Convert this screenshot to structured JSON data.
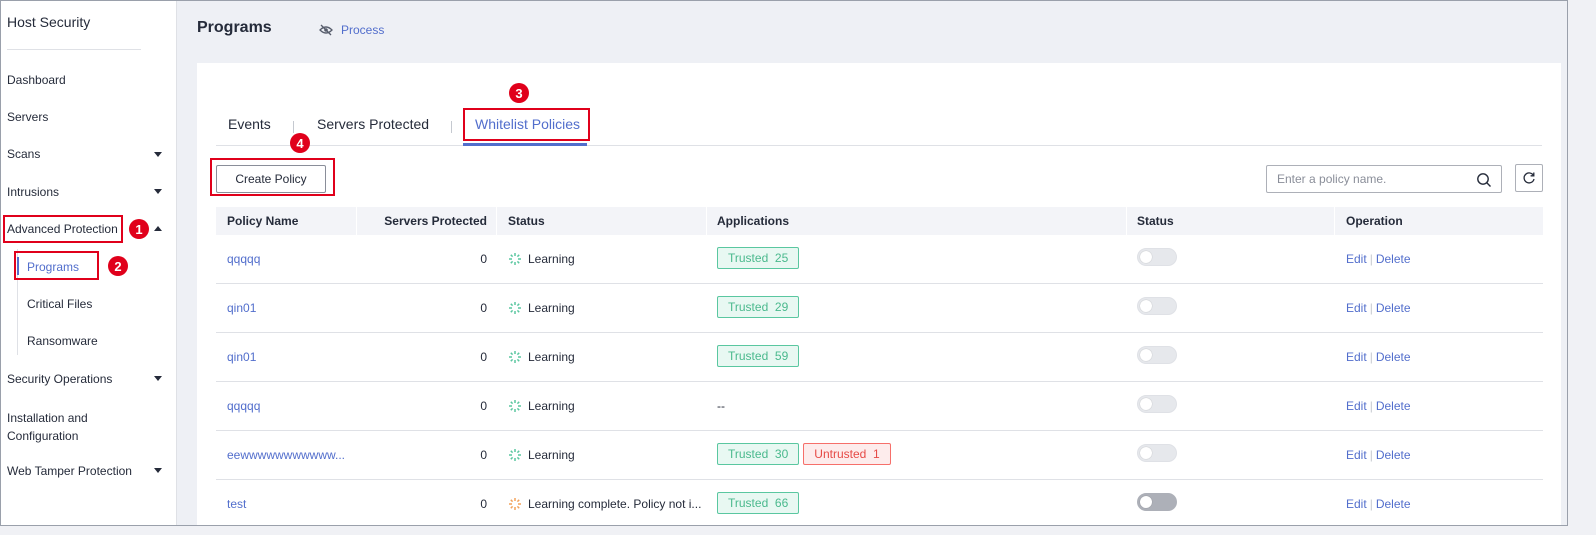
{
  "sidebar": {
    "title": "Host Security",
    "items": [
      {
        "label": "Dashboard"
      },
      {
        "label": "Servers"
      },
      {
        "label": "Scans"
      },
      {
        "label": "Intrusions"
      },
      {
        "label": "Advanced Protection"
      },
      {
        "label": "Security Operations"
      },
      {
        "label": "Installation and Configuration"
      },
      {
        "label": "Web Tamper Protection"
      }
    ],
    "sub_items": [
      {
        "label": "Programs"
      },
      {
        "label": "Critical Files"
      },
      {
        "label": "Ransomware"
      }
    ]
  },
  "header": {
    "title": "Programs",
    "process_link": "Process"
  },
  "tabs": [
    {
      "label": "Events"
    },
    {
      "label": "Servers Protected"
    },
    {
      "label": "Whitelist Policies"
    }
  ],
  "toolbar": {
    "create_label": "Create Policy",
    "search_placeholder": "Enter a policy name.",
    "search_value": ""
  },
  "table": {
    "columns": [
      "Policy Name",
      "Servers Protected",
      "Status",
      "Applications",
      "Status",
      "Operation"
    ],
    "rows": [
      {
        "name": "qqqqq",
        "servers": "0",
        "status": "Learning",
        "apps": [
          {
            "label": "Trusted",
            "count": "25"
          }
        ],
        "apps_empty": "",
        "edit": "Edit",
        "delete": "Delete"
      },
      {
        "name": "qin01",
        "servers": "0",
        "status": "Learning",
        "apps": [
          {
            "label": "Trusted",
            "count": "29"
          }
        ],
        "apps_empty": "",
        "edit": "Edit",
        "delete": "Delete"
      },
      {
        "name": "qin01",
        "servers": "0",
        "status": "Learning",
        "apps": [
          {
            "label": "Trusted",
            "count": "59"
          }
        ],
        "apps_empty": "",
        "edit": "Edit",
        "delete": "Delete"
      },
      {
        "name": "qqqqq",
        "servers": "0",
        "status": "Learning",
        "apps": [],
        "apps_empty": "--",
        "edit": "Edit",
        "delete": "Delete"
      },
      {
        "name": "eewwwwwwwwwww...",
        "servers": "0",
        "status": "Learning",
        "apps": [
          {
            "label": "Trusted",
            "count": "30"
          },
          {
            "label": "Untrusted",
            "count": "1"
          }
        ],
        "apps_empty": "",
        "edit": "Edit",
        "delete": "Delete"
      },
      {
        "name": "test",
        "servers": "0",
        "status": "Learning complete. Policy not i...",
        "apps": [
          {
            "label": "Trusted",
            "count": "66"
          }
        ],
        "apps_empty": "",
        "edit": "Edit",
        "delete": "Delete"
      }
    ]
  },
  "annotations": {
    "badge_1": "1",
    "badge_2": "2",
    "badge_3": "3",
    "badge_4": "4"
  },
  "colors": {
    "accent": "#526ecc",
    "annotation_red": "#e0001b",
    "trusted_green": "#4ab98d",
    "untrusted_red": "#e64a46"
  }
}
